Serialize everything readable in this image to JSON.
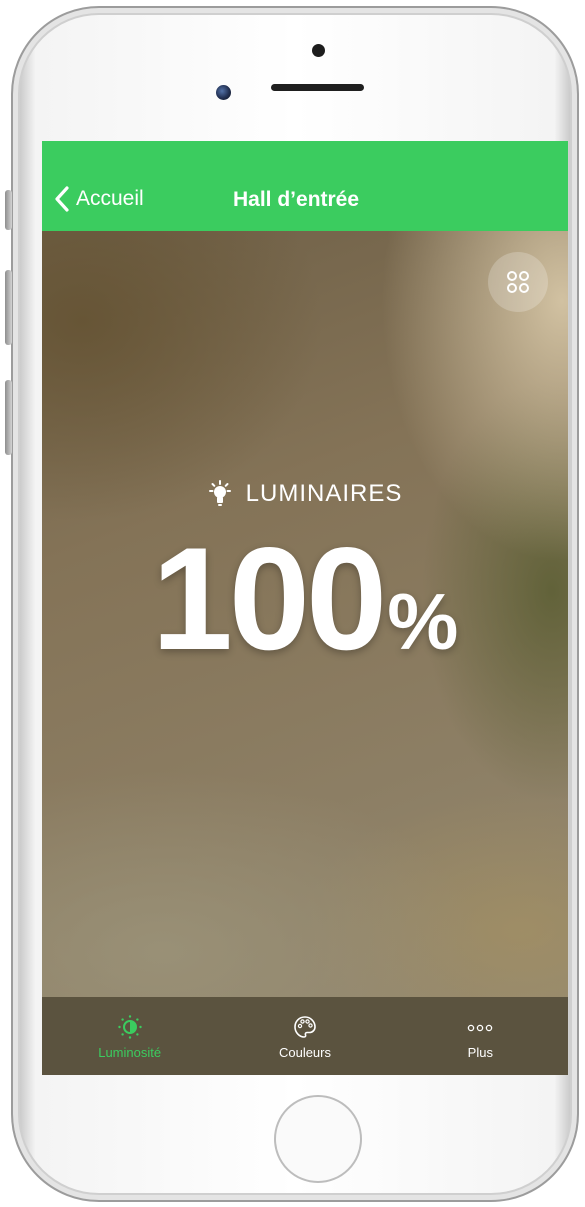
{
  "navbar": {
    "back_label": "Accueil",
    "title": "Hall d’entrée",
    "background_color": "#3bcc5f"
  },
  "main": {
    "group_icon": "lightbulb-icon",
    "group_label": "LUMINAIRES",
    "level_value": "100",
    "level_unit": "%",
    "grid_button_icon": "four-dots-grid-icon"
  },
  "tabbar": {
    "active_color": "#3bcc5f",
    "tabs": [
      {
        "label": "Luminosité",
        "icon": "brightness-icon",
        "active": true
      },
      {
        "label": "Couleurs",
        "icon": "palette-icon",
        "active": false
      },
      {
        "label": "Plus",
        "icon": "more-dots-icon",
        "active": false
      }
    ]
  }
}
